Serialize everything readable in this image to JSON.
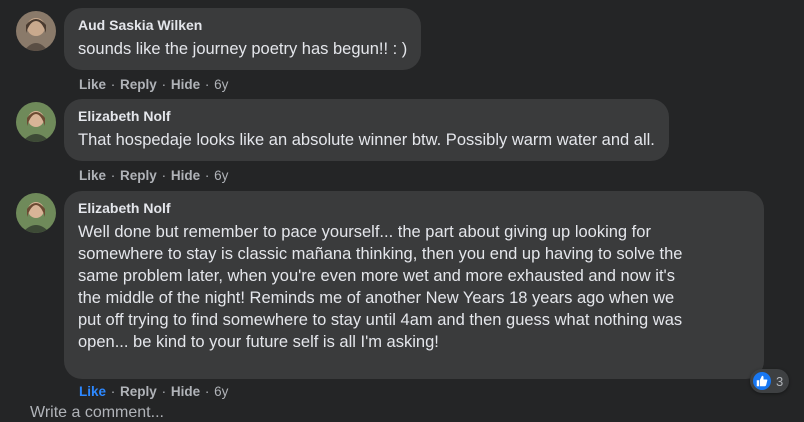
{
  "comments": [
    {
      "author": "Aud Saskia Wilken",
      "text": "sounds like the journey poetry has begun!! : )",
      "actions": {
        "like": "Like",
        "reply": "Reply",
        "hide": "Hide",
        "time": "6y",
        "separator": "·"
      }
    },
    {
      "author": "Elizabeth Nolf",
      "text": "That hospedaje looks like an absolute winner btw. Possibly warm water and all.",
      "actions": {
        "like": "Like",
        "reply": "Reply",
        "hide": "Hide",
        "time": "6y",
        "separator": "·"
      }
    },
    {
      "author": "Elizabeth Nolf",
      "text": "Well done but remember to pace yourself... the part about giving up looking for\nsomewhere to stay is classic mañana thinking, then you end up having to solve the\nsame problem later, when you're even more wet and more exhausted and now it's\nthe middle of the night! Reminds me of another New Years 18 years ago when we\nput off trying to find somewhere to stay until 4am and then guess what nothing was\nopen... be kind to your future self is all I'm asking!",
      "actions": {
        "like": "Like",
        "reply": "Reply",
        "hide": "Hide",
        "time": "6y",
        "separator": "·"
      },
      "liked": true,
      "reactions": {
        "icon": "thumbs-up-icon",
        "count": "3"
      }
    }
  ],
  "composer": {
    "placeholder": "Write a comment..."
  },
  "colors": {
    "background": "#242526",
    "bubble": "#3a3b3c",
    "text": "#e4e6eb",
    "secondary": "#b0b3b8",
    "like_active": "#2d88ff",
    "reaction_badge": "#1877f2"
  }
}
